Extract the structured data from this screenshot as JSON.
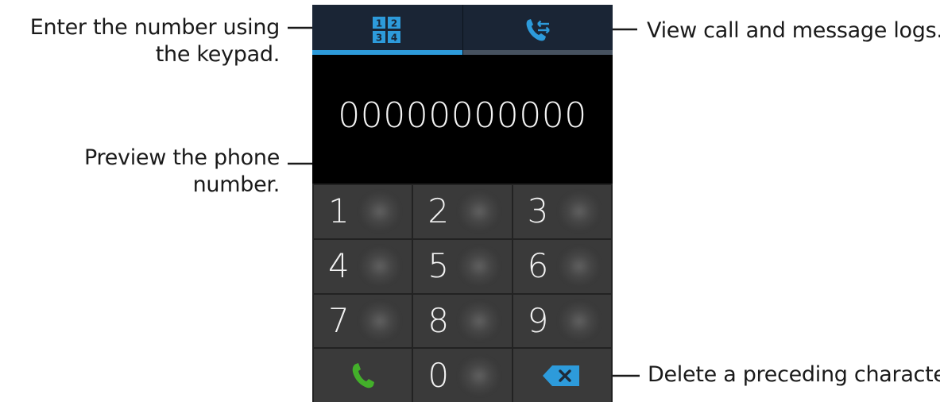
{
  "callouts": {
    "keypad": "Enter the number using the keypad.",
    "logs": "View call and message logs.",
    "preview": "Preview the phone number.",
    "delete": "Delete a preceding character."
  },
  "tabs": [
    {
      "name": "keypad",
      "icon": "keypad-grid-icon",
      "active": true,
      "glyphs": [
        "1",
        "2",
        "3",
        "4"
      ]
    },
    {
      "name": "logs",
      "icon": "call-log-icon",
      "active": false
    }
  ],
  "display": {
    "number": "00000000000"
  },
  "keypad": {
    "keys": [
      "1",
      "2",
      "3",
      "4",
      "5",
      "6",
      "7",
      "8",
      "9",
      "0"
    ],
    "call_icon": "phone-call-icon",
    "delete_icon": "backspace-icon"
  },
  "colors": {
    "tab_bar": "#1a2535",
    "active_tab_accent": "#2d9bdb",
    "icon_blue": "#2d9bdb",
    "call_green": "#43b02a",
    "key_bg": "#3a3a3a"
  }
}
